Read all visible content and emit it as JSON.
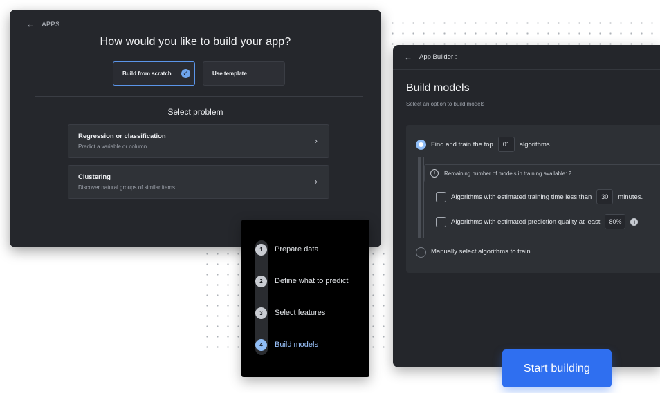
{
  "app_selection": {
    "back_label": "APPS",
    "title": "How would you like to build your app?",
    "choices": [
      {
        "label": "Build from scratch",
        "selected": true
      },
      {
        "label": "Use template",
        "selected": false
      }
    ],
    "section_title": "Select problem",
    "problems": [
      {
        "title": "Regression or classification",
        "description": "Predict a variable or column"
      },
      {
        "title": "Clustering",
        "description": "Discover natural groups of similar items"
      }
    ]
  },
  "steps": [
    {
      "num": "1",
      "label": "Prepare data",
      "active": false
    },
    {
      "num": "2",
      "label": "Define what to predict",
      "active": false
    },
    {
      "num": "3",
      "label": "Select features",
      "active": false
    },
    {
      "num": "4",
      "label": "Build models",
      "active": true
    }
  ],
  "builder": {
    "breadcrumb": "App Builder :",
    "title": "Build models",
    "subtitle": "Select an option to build models",
    "option_top": {
      "prefix": "Find and train the top",
      "value": "01",
      "suffix": "algorithms.",
      "selected": true
    },
    "info": "Remaining number of models in training available:  2",
    "filter_time": {
      "prefix": "Algorithms with estimated training time less than",
      "value": "30",
      "suffix": "minutes."
    },
    "filter_quality": {
      "prefix": "Algorithms with estimated prediction quality at least",
      "value": "80%"
    },
    "option_manual": {
      "label": "Manually select algorithms to train.",
      "selected": false
    }
  },
  "cta": {
    "label": "Start building"
  },
  "colors": {
    "accent": "#2f6ff0",
    "active_step": "#9cc5ff",
    "panel": "#25272c"
  }
}
